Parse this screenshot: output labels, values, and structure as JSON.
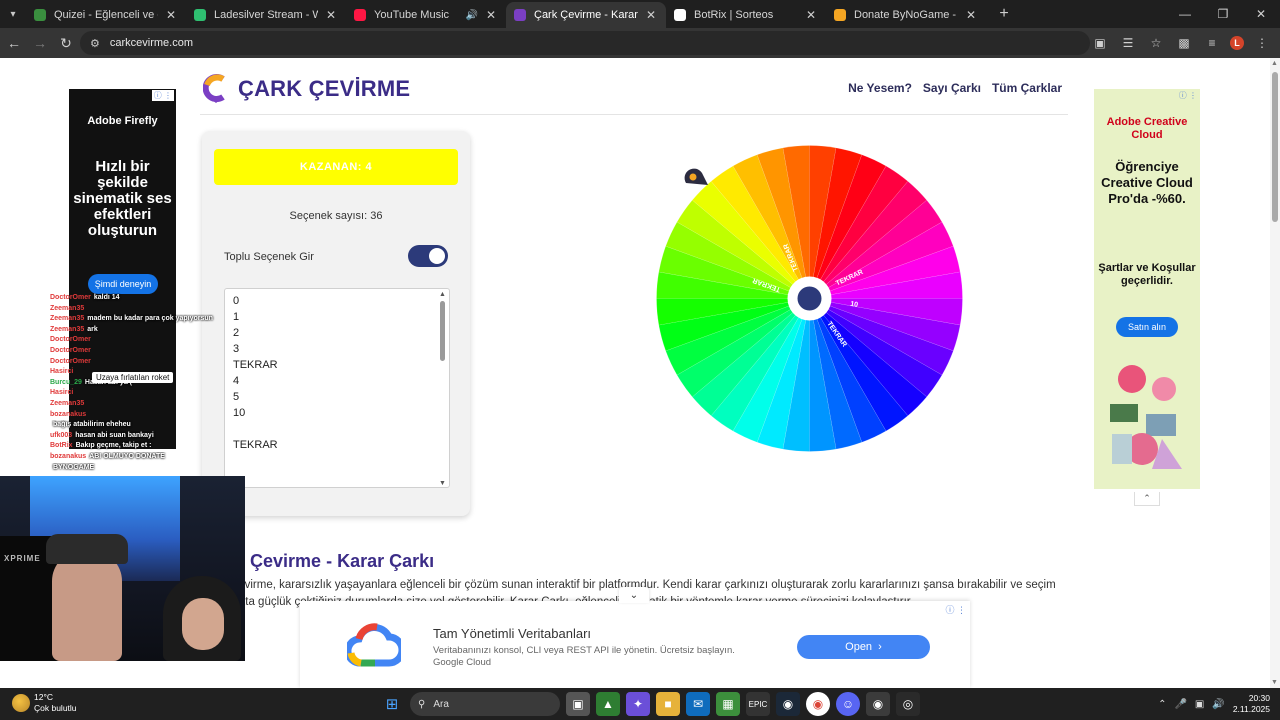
{
  "browser": {
    "tabs": [
      {
        "title": "Quizei - Eğlenceli ve etkileşimli",
        "color": "#3a8f3f",
        "active": false,
        "audio": false
      },
      {
        "title": "Ladesilver Stream - Watch Live",
        "color": "#2fbf71",
        "active": false,
        "audio": false
      },
      {
        "title": "YouTube Music",
        "color": "#ff1744",
        "active": false,
        "audio": true
      },
      {
        "title": "Çark Çevirme - Karar Çarkı",
        "color": "#7b3fc4",
        "active": true,
        "audio": false
      },
      {
        "title": "BotRix | Sorteos",
        "color": "#ffffff",
        "active": false,
        "audio": false
      },
      {
        "title": "Donate ByNoGame - BNG Strea",
        "color": "#f5a623",
        "active": false,
        "audio": false
      }
    ],
    "url": "carkcevirme.com",
    "profile_initial": "L"
  },
  "site": {
    "title": "ÇARK ÇEVİRME",
    "nav": [
      "Ne Yesem?",
      "Sayı Çarkı",
      "Tüm Çarklar"
    ]
  },
  "controls": {
    "winner_text": "KAZANAN: 4",
    "option_count": "Seçenek sayısı: 36",
    "bulk_label": "Toplu Seçenek Gir",
    "bulk_enabled": true,
    "options": [
      "0",
      "1",
      "2",
      "3",
      "TEKRAR",
      "4",
      "5",
      "10",
      "",
      "TEKRAR"
    ]
  },
  "wheel": {
    "segments": 36,
    "labels": [
      "TEKRAR",
      "TEKRAR",
      "TEKRAR",
      "TEKRAR",
      "10"
    ]
  },
  "article": {
    "title": "Çark Çevirme - Karar Çarkı",
    "text": "Çark çevirme, kararsızlık yaşayanlara eğlenceli bir çözüm sunan interaktif bir platformdur. Kendi karar çarkınızı oluşturarak zorlu kararlarınızı şansa bırakabilir ve seçim yapmakta güçlük çektiğiniz durumlarda size yol gösterebilir. Karar Çarkı, eğlenceli ve pratik bir yöntemle karar verme sürecinizi kolaylaştırır."
  },
  "ads": {
    "left": {
      "brand": "Adobe Firefly",
      "headline": "Hızlı bir şekilde sinematik ses efektleri oluşturun",
      "cta": "Şimdi deneyin"
    },
    "right": {
      "brand": "Adobe Creative Cloud",
      "headline": "Öğrenciye Creative Cloud Pro'da -%60.",
      "sub": "Şartlar ve Koşullar geçerlidir.",
      "cta": "Satın alın"
    },
    "bottom": {
      "title": "Tam Yönetimli Veritabanları",
      "desc": "Veritabanınızı konsol, CLI veya REST API ile yönetin. Ücretsiz başlayın. Google Cloud",
      "cta": "Open"
    }
  },
  "stream_overlay": {
    "chat": [
      {
        "user": "DoctorOmer",
        "msg": "kaldı 14"
      },
      {
        "user": "Zeeman35",
        "msg": ""
      },
      {
        "user": "Zeeman35",
        "msg": "madem bu kadar para çok yapıyorsun"
      },
      {
        "user": "Zeeman35",
        "msg": "ark"
      },
      {
        "user": "DoctorOmer",
        "msg": ""
      },
      {
        "user": "DoctorOmer",
        "msg": ""
      },
      {
        "user": "DoctorOmer",
        "msg": ""
      },
      {
        "user": "Hasirci",
        "msg": ""
      },
      {
        "user": "Burcu_29",
        "msg": "Hasan abi ya ("
      },
      {
        "user": "Hasirci",
        "msg": ""
      },
      {
        "user": "Zeeman35",
        "msg": ""
      },
      {
        "user": "bozanakus",
        "msg": ""
      },
      {
        "user": "",
        "msg": "bağış atabilirim eheheu"
      },
      {
        "user": "ufk003",
        "msg": "hasan abi suan bankayi"
      },
      {
        "user": "BotRix",
        "msg": "Bakıp geçme, takip et :"
      },
      {
        "user": "bozanakus",
        "msg": "ABI OLMUYO DONATE"
      },
      {
        "user": "",
        "msg": "BYNOGAME"
      }
    ],
    "bubble": "Uzaya fırlatılan roket",
    "chair_brand": "XPRIME"
  },
  "taskbar": {
    "temp": "12°C",
    "weather": "Çok bulutlu",
    "search": "Ara",
    "time": "20:30",
    "date": "2.11.2025"
  }
}
